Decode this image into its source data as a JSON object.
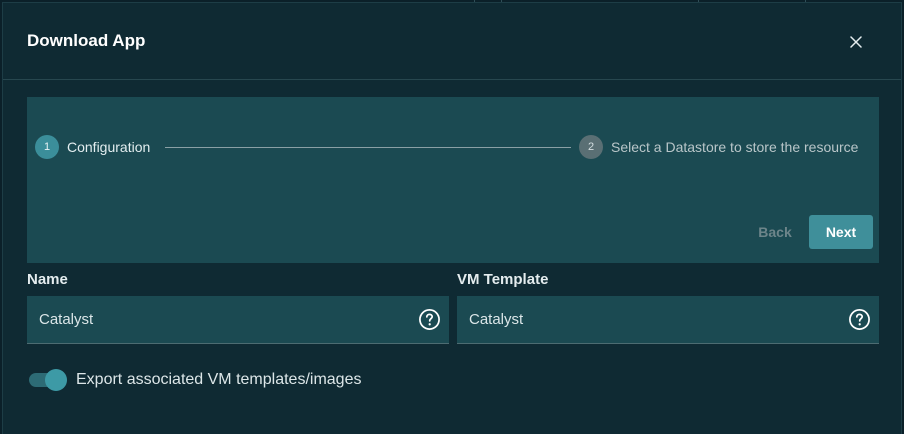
{
  "dialog": {
    "title": "Download App",
    "close_icon": "close-icon"
  },
  "stepper": {
    "steps": [
      {
        "number": "1",
        "label": "Configuration",
        "state": "active"
      },
      {
        "number": "2",
        "label": "Select a Datastore to store the resource",
        "state": "inactive"
      }
    ],
    "back_label": "Back",
    "next_label": "Next"
  },
  "form": {
    "name": {
      "label": "Name",
      "value": "Catalyst",
      "help_icon": "help-circle-icon"
    },
    "vm_template": {
      "label": "VM Template",
      "value": "Catalyst",
      "help_icon": "help-circle-icon"
    },
    "export_toggle": {
      "label": "Export associated VM templates/images",
      "checked": true
    }
  },
  "colors": {
    "background": "#0f2a33",
    "panel": "#1b4a52",
    "accent": "#3f8f9a",
    "text": "#e6eef0"
  }
}
